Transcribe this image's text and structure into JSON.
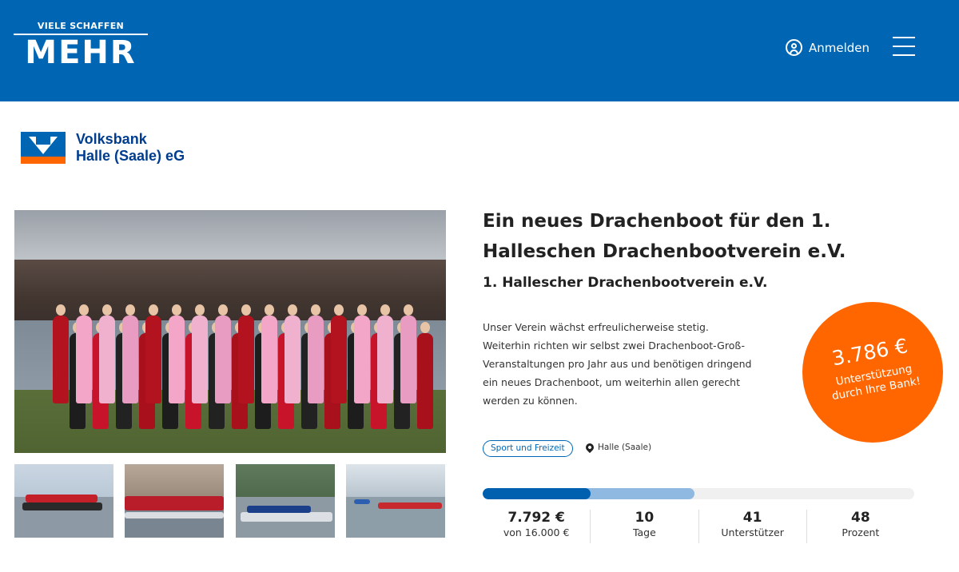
{
  "header": {
    "logo_small": "VIELE SCHAFFEN",
    "logo_big": "MEHR",
    "login_label": "Anmelden"
  },
  "bank": {
    "name_line1": "Volksbank",
    "name_line2": "Halle (Saale) eG"
  },
  "project": {
    "title": "Ein neues Drachenboot für den 1. Halleschen Drachenbootverein e.V.",
    "organizer": "1. Hallescher Drachenbootverein e.V.",
    "description": "Unser Verein wächst erfreulicherweise stetig. Weiterhin richten wir selbst zwei Drachenboot-Groß-Veranstaltungen pro Jahr aus und benötigen dringend ein neues Drachenboot, um weiterhin allen gerecht werden zu können.",
    "category": "Sport und Freizeit",
    "location": "Halle (Saale)"
  },
  "bank_support": {
    "amount": "3.786 €",
    "text_line1": "Unterstützung",
    "text_line2": "durch Ihre Bank!"
  },
  "progress": {
    "funded_fraction": 0.25,
    "bank_fraction": 0.49
  },
  "stats": {
    "amount": "7.792 €",
    "goal": "von 16.000 €",
    "days_value": "10",
    "days_label": "Tage",
    "supporters_value": "41",
    "supporters_label": "Unterstützer",
    "percent_value": "48",
    "percent_label": "Prozent"
  },
  "colors": {
    "brand_blue": "#0066b3",
    "accent_orange": "#ff6600"
  }
}
